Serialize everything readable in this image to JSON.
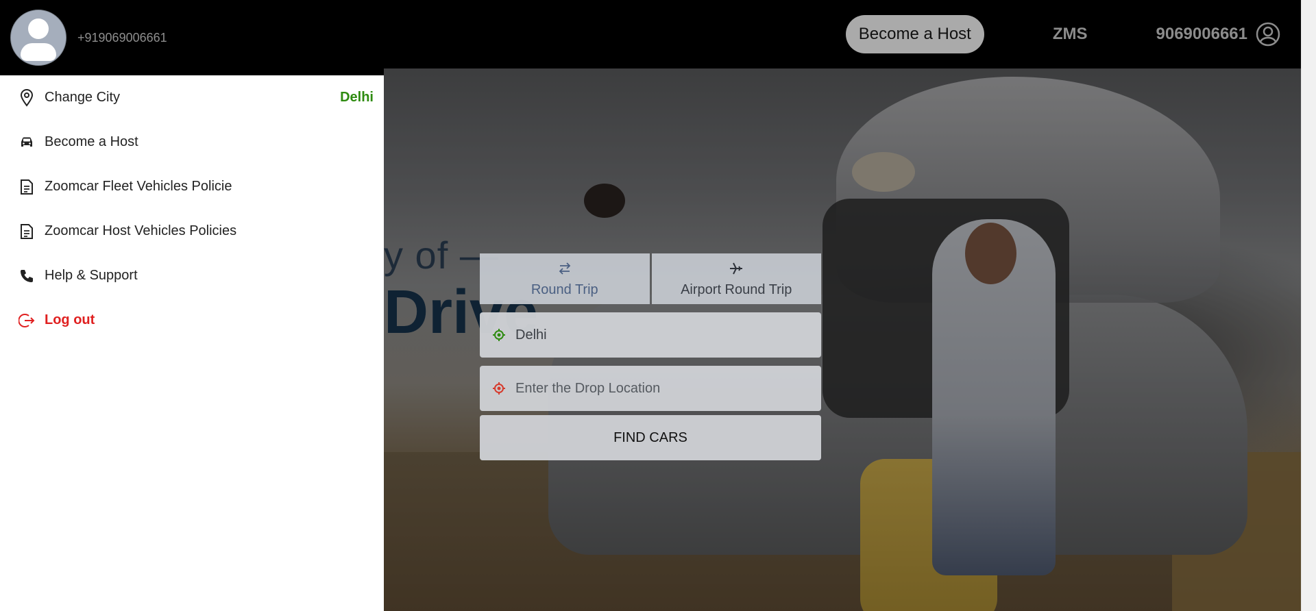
{
  "header": {
    "become_host_label": "Become a Host",
    "zms_label": "ZMS",
    "account_number": "9069006661"
  },
  "hero": {
    "tagline": "y of —",
    "headline": "Drive"
  },
  "booking": {
    "tabs": [
      {
        "label": "Round Trip",
        "icon": "swap-arrows-icon",
        "active": true
      },
      {
        "label": "Airport Round Trip",
        "icon": "airplane-icon",
        "active": false
      }
    ],
    "pickup": {
      "value": "Delhi",
      "icon": "pickup-location-icon",
      "color": "#2e8b10"
    },
    "drop": {
      "placeholder": "Enter the Drop Location",
      "icon": "drop-location-icon",
      "color": "#d63a2c"
    },
    "find_label": "FIND CARS"
  },
  "drawer": {
    "phone": "+919069006661",
    "items": [
      {
        "label": "Change City",
        "value": "Delhi",
        "icon": "map-pin-icon"
      },
      {
        "label": "Become a Host",
        "icon": "car-icon"
      },
      {
        "label": "Zoomcar Fleet Vehicles Policie",
        "icon": "document-icon"
      },
      {
        "label": "Zoomcar Host Vehicles Policies",
        "icon": "document-icon"
      },
      {
        "label": "Help & Support",
        "icon": "phone-icon"
      },
      {
        "label": "Log out",
        "icon": "logout-icon"
      }
    ]
  },
  "colors": {
    "accent_green": "#2e8b10",
    "logout_red": "#e02020",
    "header_bg": "#000000"
  }
}
